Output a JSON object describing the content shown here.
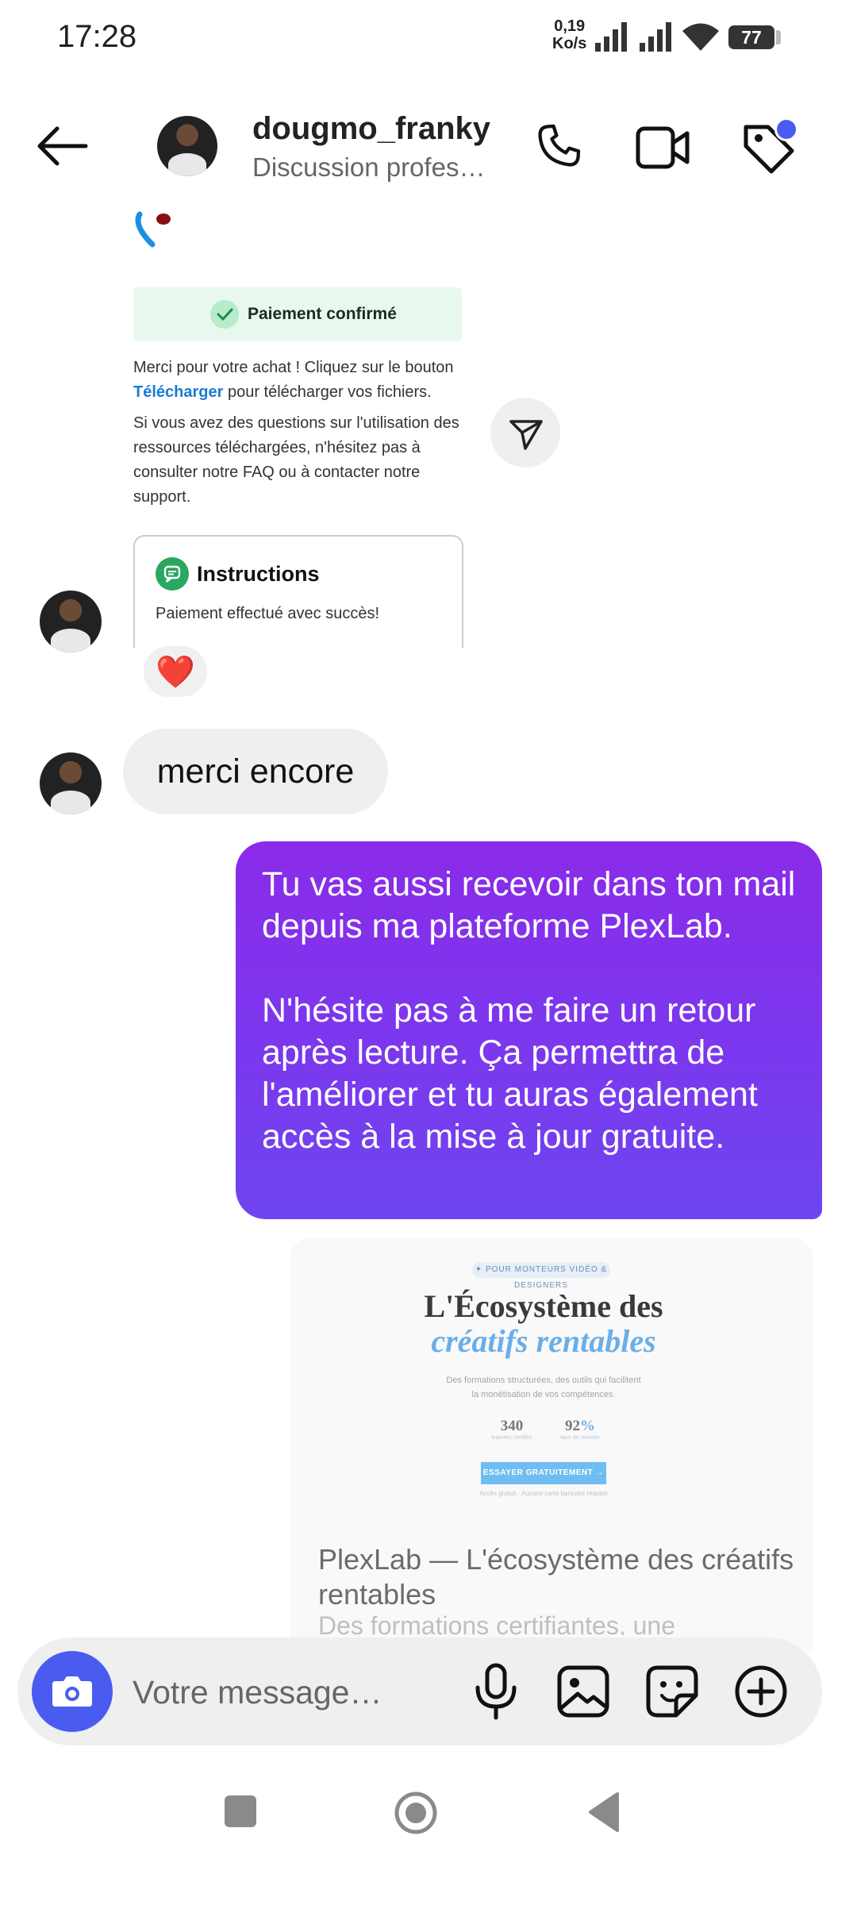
{
  "status_bar": {
    "time": "17:28",
    "net_speed_value": "0,19",
    "net_speed_unit": "Ko/s",
    "battery": "77",
    "icons": [
      "signal-icon",
      "signal-icon",
      "wifi-icon",
      "battery-icon"
    ]
  },
  "header": {
    "username": "dougmo_franky",
    "subtitle": "Discussion profes…",
    "icons": [
      "back-arrow-icon",
      "phone-icon",
      "video-camera-icon",
      "tag-icon"
    ],
    "accent": "#4a5cf0"
  },
  "receipt": {
    "paid_label": "Paiement confirmé",
    "thanks_before": "Merci pour votre achat ! Cliquez sur le bouton",
    "download_link": "Télécharger",
    "thanks_after": "pour télécharger vos fichiers.",
    "help_text": "Si vous avez des questions sur l'utilisation des ressources téléchargées, n'hésitez pas à consulter notre FAQ ou à contacter notre support.",
    "instructions_title": "Instructions",
    "instructions_body": "Paiement effectué avec succès!",
    "reaction": "❤️"
  },
  "messages": {
    "incoming": "merci encore",
    "outgoing": "Tu vas aussi recevoir dans ton mail depuis ma plateforme PlexLab.\n\nN'hésite pas à me faire un retour après lecture. Ça permettra de l'améliorer et tu auras également accès à la mise à jour gratuite.",
    "outgoing_gradient": [
      "#8a2be9",
      "#6e45f0"
    ]
  },
  "link_preview": {
    "pill": "✦ POUR MONTEURS VIDÉO & DESIGNERS",
    "headline_1": "L'Écosystème des",
    "headline_2": "créatifs rentables",
    "subhead": "Des formations structurées, des outils qui facilitent la monétisation de vos compétences.",
    "stat_1_value": "340",
    "stat_1_label": "learners certifiés",
    "stat_2_value": "92",
    "stat_2_label": "taux de réussite",
    "cta": "ESSAYER GRATUITEMENT →",
    "cta_note": "Accès gratuit · Aucune carte bancaire requise",
    "title": "PlexLab — L'écosystème des créatifs rentables",
    "description": "Des formations certifiantes, une"
  },
  "composer": {
    "placeholder": "Votre message…",
    "icons": [
      "camera-icon",
      "microphone-icon",
      "image-icon",
      "sticker-icon",
      "plus-circle-icon"
    ]
  },
  "nav_bar": {
    "icons": [
      "recents-square-icon",
      "home-circle-icon",
      "back-triangle-icon"
    ]
  }
}
